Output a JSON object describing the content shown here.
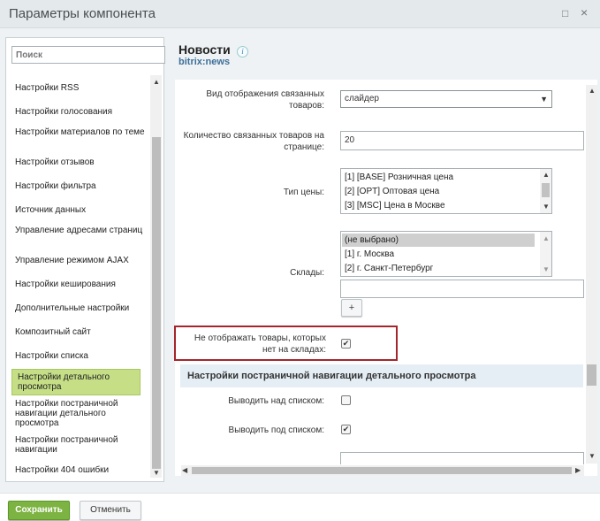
{
  "window": {
    "title": "Параметры компонента"
  },
  "search": {
    "placeholder": "Поиск"
  },
  "sidebar": {
    "items": [
      {
        "label": "Настройки RSS"
      },
      {
        "label": "Настройки голосования"
      },
      {
        "label": "Настройки материалов по теме"
      },
      {
        "label": "Настройки отзывов"
      },
      {
        "label": "Настройки фильтра"
      },
      {
        "label": "Источник данных"
      },
      {
        "label": "Управление адресами страниц"
      },
      {
        "label": "Управление режимом AJAX"
      },
      {
        "label": "Настройки кеширования"
      },
      {
        "label": "Дополнительные настройки"
      },
      {
        "label": "Композитный сайт"
      },
      {
        "label": "Настройки списка"
      },
      {
        "label": "Настройки детального просмотра"
      },
      {
        "label": "Настройки постраничной навигации детального просмотра"
      },
      {
        "label": "Настройки постраничной навигации"
      },
      {
        "label": "Настройки 404 ошибки"
      }
    ]
  },
  "header": {
    "title": "Новости",
    "subtitle": "bitrix:news"
  },
  "form": {
    "related_view": {
      "label": "Вид отображения связанных товаров:",
      "value": "слайдер"
    },
    "related_count": {
      "label": "Количество связанных товаров на странице:",
      "value": "20"
    },
    "price_type": {
      "label": "Тип цены:",
      "options": [
        "[1] [BASE] Розничная цена",
        "[2] [OPT] Оптовая цена",
        "[3] [MSC] Цена в Москве"
      ]
    },
    "stores": {
      "label": "Склады:",
      "options": [
        "(не выбрано)",
        "[1] г. Москва",
        "[2] г. Санкт-Петербург"
      ],
      "add_label": "+"
    },
    "hide_missing": {
      "label": "Не отображать товары, которых нет на складах:",
      "checked": true
    },
    "section_title": "Настройки постраничной навигации детального просмотра",
    "show_above": {
      "label": "Выводить над списком:",
      "checked": false
    },
    "show_below": {
      "label": "Выводить под списком:",
      "checked": true
    }
  },
  "footer": {
    "save_label": "Сохранить",
    "cancel_label": "Отменить"
  },
  "icons": {
    "info": "i",
    "restore": "□",
    "close": "×",
    "caret": "▼",
    "check": "✔"
  }
}
